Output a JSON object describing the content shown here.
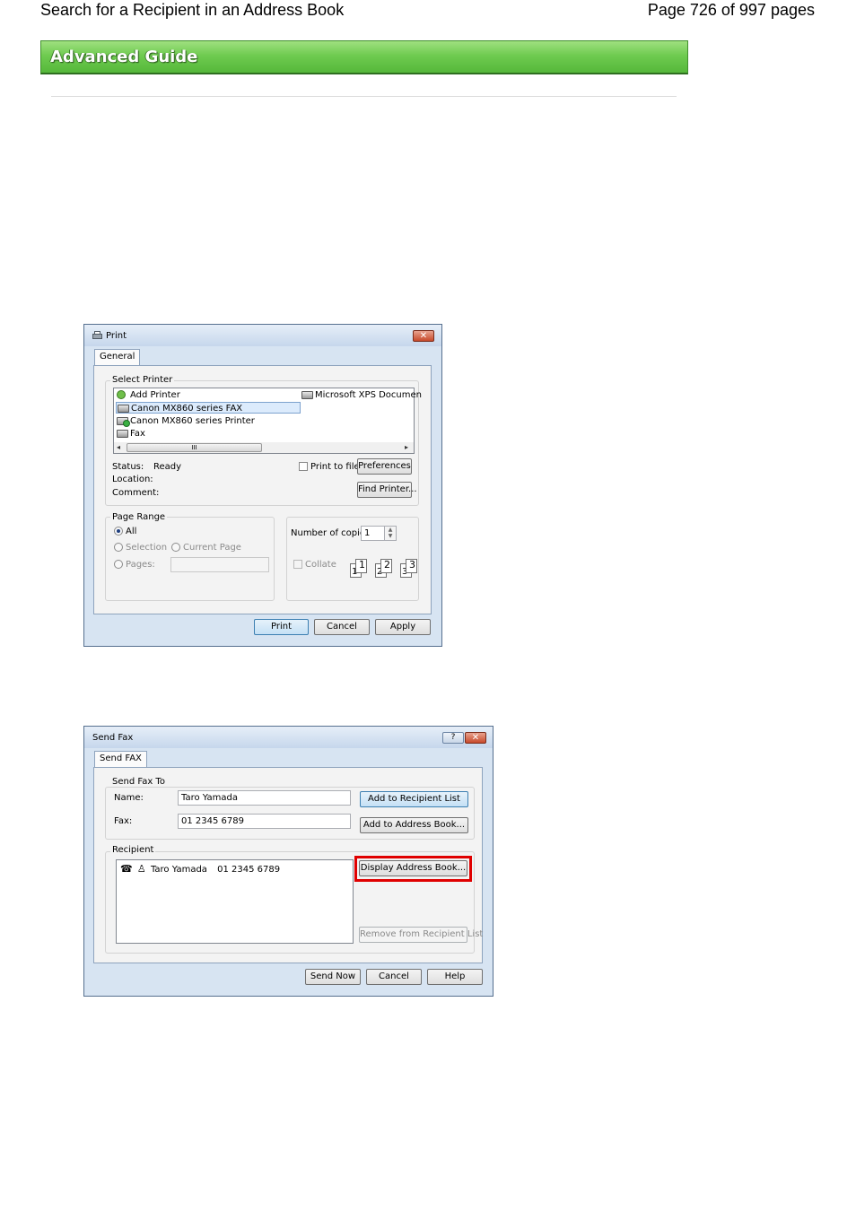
{
  "header": {
    "title": "Search for a Recipient in an Address Book",
    "page_info": "Page 726 of 997 pages"
  },
  "banner": {
    "label": "Advanced Guide"
  },
  "print_dialog": {
    "title": "Print",
    "tab": "General",
    "select_printer_label": "Select Printer",
    "printers": [
      "Add Printer",
      "Canon MX860 series FAX",
      "Canon MX860 series Printer",
      "Fax",
      "Microsoft XPS Documen"
    ],
    "selected_printer": "Canon MX860 series FAX",
    "scroll_thumb": "III",
    "status_label": "Status:",
    "status_value": "Ready",
    "location_label": "Location:",
    "comment_label": "Comment:",
    "print_to_file": "Print to file",
    "preferences": "Preferences",
    "find_printer": "Find Printer...",
    "page_range_label": "Page Range",
    "all": "All",
    "selection": "Selection",
    "current_page": "Current Page",
    "pages": "Pages:",
    "copies_label": "Number of copies:",
    "copies_value": "1",
    "collate": "Collate",
    "collate_pages": [
      "1",
      "1",
      "2",
      "2",
      "3",
      "3"
    ],
    "buttons": {
      "print": "Print",
      "cancel": "Cancel",
      "apply": "Apply"
    }
  },
  "fax_dialog": {
    "title": "Send Fax",
    "help_glyph": "?",
    "tab": "Send FAX",
    "send_to_label": "Send Fax To",
    "name_label": "Name:",
    "name_value": "Taro Yamada",
    "fax_label": "Fax:",
    "fax_value": "01 2345 6789",
    "add_to_recipient": "Add to Recipient List",
    "add_to_address_book": "Add to Address Book...",
    "recipient_label": "Recipient",
    "recipient_name": "Taro Yamada",
    "recipient_fax": "01 2345 6789",
    "display_address_book": "Display Address Book...",
    "remove_from_recipient": "Remove from Recipient List",
    "buttons": {
      "send_now": "Send Now",
      "cancel": "Cancel",
      "help": "Help"
    }
  },
  "colors": {
    "banner": "#6fcb50",
    "highlight": "#e00000",
    "close": "#c84a2c"
  }
}
